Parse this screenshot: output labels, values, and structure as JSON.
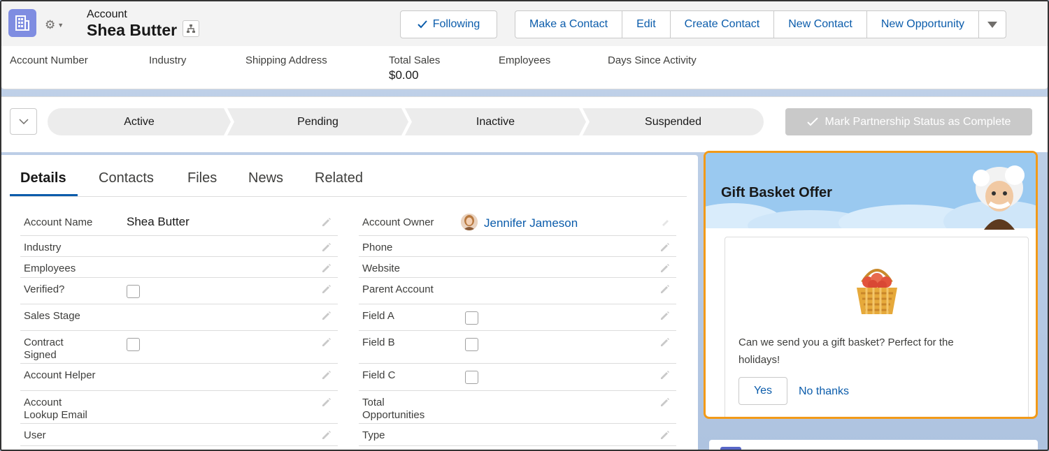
{
  "header": {
    "object_label": "Account",
    "record_title": "Shea Butter",
    "following_label": "Following",
    "actions": [
      "Make a Contact",
      "Edit",
      "Create Contact",
      "New Contact",
      "New Opportunity"
    ],
    "highlights": [
      {
        "label": "Account Number",
        "value": ""
      },
      {
        "label": "Industry",
        "value": ""
      },
      {
        "label": "Shipping Address",
        "value": ""
      },
      {
        "label": "Total Sales",
        "value": "$0.00"
      },
      {
        "label": "Employees",
        "value": ""
      },
      {
        "label": "Days Since Activity",
        "value": ""
      }
    ]
  },
  "path": {
    "stages": [
      "Active",
      "Pending",
      "Inactive",
      "Suspended"
    ],
    "mark_complete_label": "Mark Partnership Status as Complete"
  },
  "tabs": [
    "Details",
    "Contacts",
    "Files",
    "News",
    "Related"
  ],
  "details": {
    "left": [
      {
        "label": "Account Name",
        "value": "Shea Butter",
        "type": "text"
      },
      {
        "label": "Industry",
        "value": "",
        "type": "text"
      },
      {
        "label": "Employees",
        "value": "",
        "type": "text"
      },
      {
        "label": "Verified?",
        "value": "",
        "type": "checkbox"
      },
      {
        "label": "Sales Stage",
        "value": "",
        "type": "text"
      },
      {
        "label": "Contract\nSigned",
        "value": "",
        "type": "checkbox"
      },
      {
        "label": "Account Helper",
        "value": "",
        "type": "text"
      },
      {
        "label": "Account\nLookup Email",
        "value": "",
        "type": "text"
      },
      {
        "label": "User",
        "value": "",
        "type": "text"
      }
    ],
    "right": [
      {
        "label": "Account Owner",
        "value": "Jennifer Jameson",
        "type": "owner"
      },
      {
        "label": "Phone",
        "value": "",
        "type": "text"
      },
      {
        "label": "Website",
        "value": "",
        "type": "text"
      },
      {
        "label": "Parent Account",
        "value": "",
        "type": "text"
      },
      {
        "label": "Field A",
        "value": "",
        "type": "checkbox"
      },
      {
        "label": "Field B",
        "value": "",
        "type": "checkbox"
      },
      {
        "label": "Field C",
        "value": "",
        "type": "checkbox"
      },
      {
        "label": "Total\nOpportunities",
        "value": "",
        "type": "text"
      },
      {
        "label": "Type",
        "value": "",
        "type": "text"
      }
    ]
  },
  "gift": {
    "title": "Gift Basket Offer",
    "message": "Can we send you a gift basket? Perfect for the holidays!",
    "yes_label": "Yes",
    "no_label": "No thanks"
  },
  "colors": {
    "brand_blue": "#0b5cab",
    "account_icon": "#7f8de1",
    "highlight_border": "#f29a18",
    "banner_sky": "#9ac9f0"
  }
}
